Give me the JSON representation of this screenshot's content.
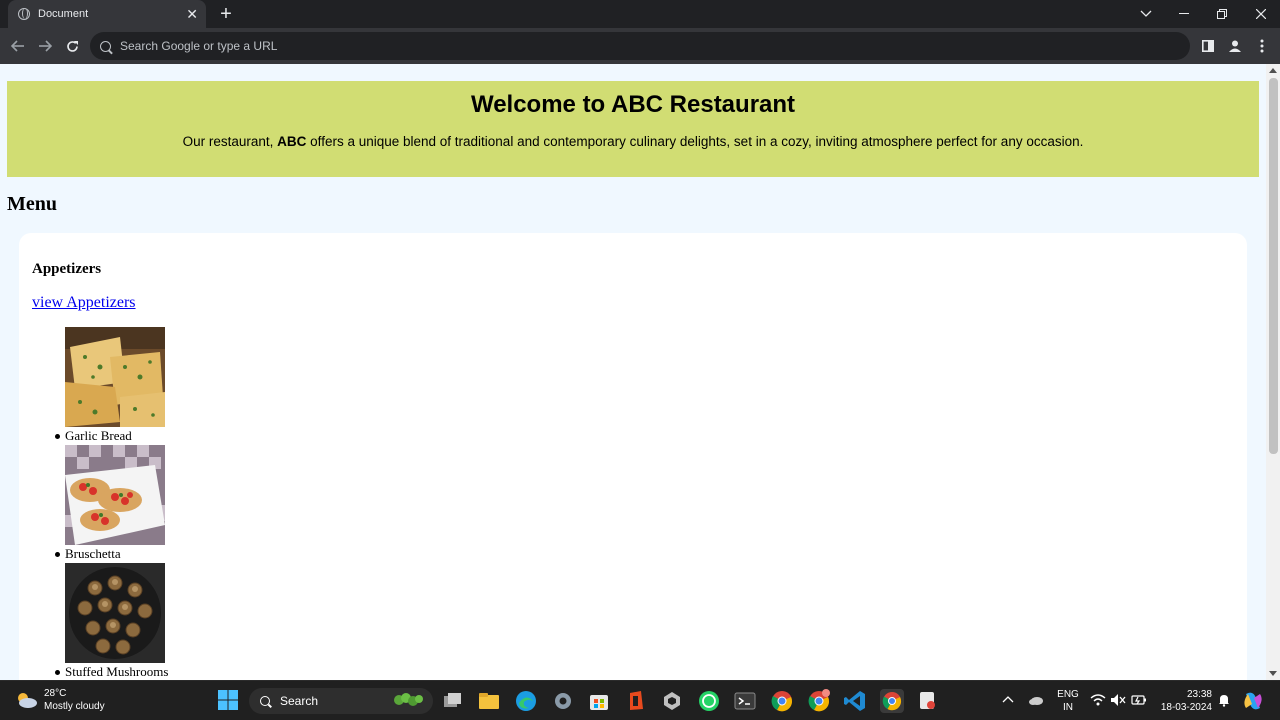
{
  "browser": {
    "tab_title": "Document",
    "tab_close": "✕",
    "new_tab": "+",
    "omnibox_placeholder": "Search Google or type a URL"
  },
  "page": {
    "hero": {
      "title": "Welcome to ABC Restaurant",
      "text_before": "Our restaurant, ",
      "text_bold": "ABC",
      "text_after": " offers a unique blend of traditional and contemporary culinary delights, set in a cozy, inviting atmosphere perfect for any occasion."
    },
    "menu_title": "Menu",
    "section": {
      "title": "Appetizers",
      "link": "view Appetizers",
      "items": [
        {
          "name": "Garlic Bread"
        },
        {
          "name": "Bruschetta"
        },
        {
          "name": "Stuffed Mushrooms"
        }
      ]
    }
  },
  "taskbar": {
    "weather_temp": "28°C",
    "weather_desc": "Mostly cloudy",
    "search_label": "Search",
    "lang_top": "ENG",
    "lang_bottom": "IN",
    "time": "23:38",
    "date": "18-03-2024"
  },
  "colors": {
    "hero_bg": "#d1dd73",
    "page_bg": "#f0f8ff",
    "link": "#0000ee"
  }
}
